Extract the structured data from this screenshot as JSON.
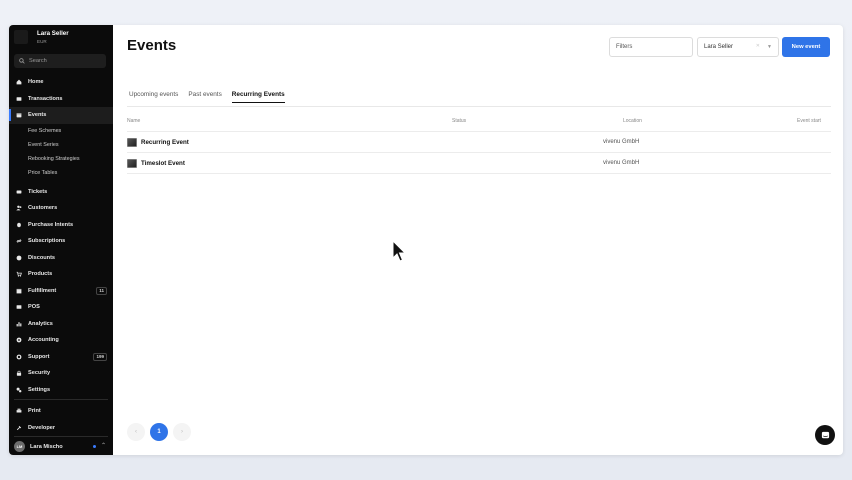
{
  "account": {
    "name": "Lara Seller",
    "currency": "EUR"
  },
  "search": {
    "placeholder": "Search"
  },
  "sidebar": {
    "items": [
      {
        "label": "Home",
        "icon": "home-icon"
      },
      {
        "label": "Transactions",
        "icon": "transactions-icon"
      },
      {
        "label": "Events",
        "icon": "events-icon",
        "active": true
      },
      {
        "label": "Tickets",
        "icon": "ticket-icon"
      },
      {
        "label": "Customers",
        "icon": "customers-icon"
      },
      {
        "label": "Purchase Intents",
        "icon": "purchase-intents-icon"
      },
      {
        "label": "Subscriptions",
        "icon": "subscriptions-icon"
      },
      {
        "label": "Discounts",
        "icon": "discount-icon"
      },
      {
        "label": "Products",
        "icon": "products-icon"
      },
      {
        "label": "Fulfillment",
        "icon": "fulfillment-icon",
        "badge": "11"
      },
      {
        "label": "POS",
        "icon": "pos-icon"
      },
      {
        "label": "Analytics",
        "icon": "analytics-icon"
      },
      {
        "label": "Accounting",
        "icon": "accounting-icon"
      },
      {
        "label": "Support",
        "icon": "support-icon",
        "badge": "199"
      },
      {
        "label": "Security",
        "icon": "lock-icon"
      },
      {
        "label": "Settings",
        "icon": "settings-icon"
      }
    ],
    "sub_items": [
      "Fee Schemes",
      "Event Series",
      "Rebooking Strategies",
      "Price Tables"
    ],
    "bottom": [
      {
        "label": "Print",
        "icon": "print-icon"
      },
      {
        "label": "Developer",
        "icon": "developer-icon"
      }
    ],
    "user": {
      "initials": "LM",
      "name": "Lara Mischo"
    }
  },
  "page": {
    "title": "Events",
    "filters_placeholder": "Filters",
    "seller_select": "Lara Seller",
    "new_event_label": "New event"
  },
  "tabs": [
    {
      "label": "Upcoming events",
      "active": false
    },
    {
      "label": "Past events",
      "active": false
    },
    {
      "label": "Recurring Events",
      "active": true
    }
  ],
  "table": {
    "columns": [
      "Name",
      "Status",
      "Location",
      "Event start"
    ],
    "rows": [
      {
        "name": "Recurring Event",
        "status": "",
        "location": "vivenu GmbH",
        "event_start": ""
      },
      {
        "name": "Timeslot Event",
        "status": "",
        "location": "vivenu GmbH",
        "event_start": ""
      }
    ]
  },
  "pagination": {
    "current": "1"
  },
  "colors": {
    "accent": "#2f74e8",
    "sidebar_bg": "#0b0b0b"
  }
}
